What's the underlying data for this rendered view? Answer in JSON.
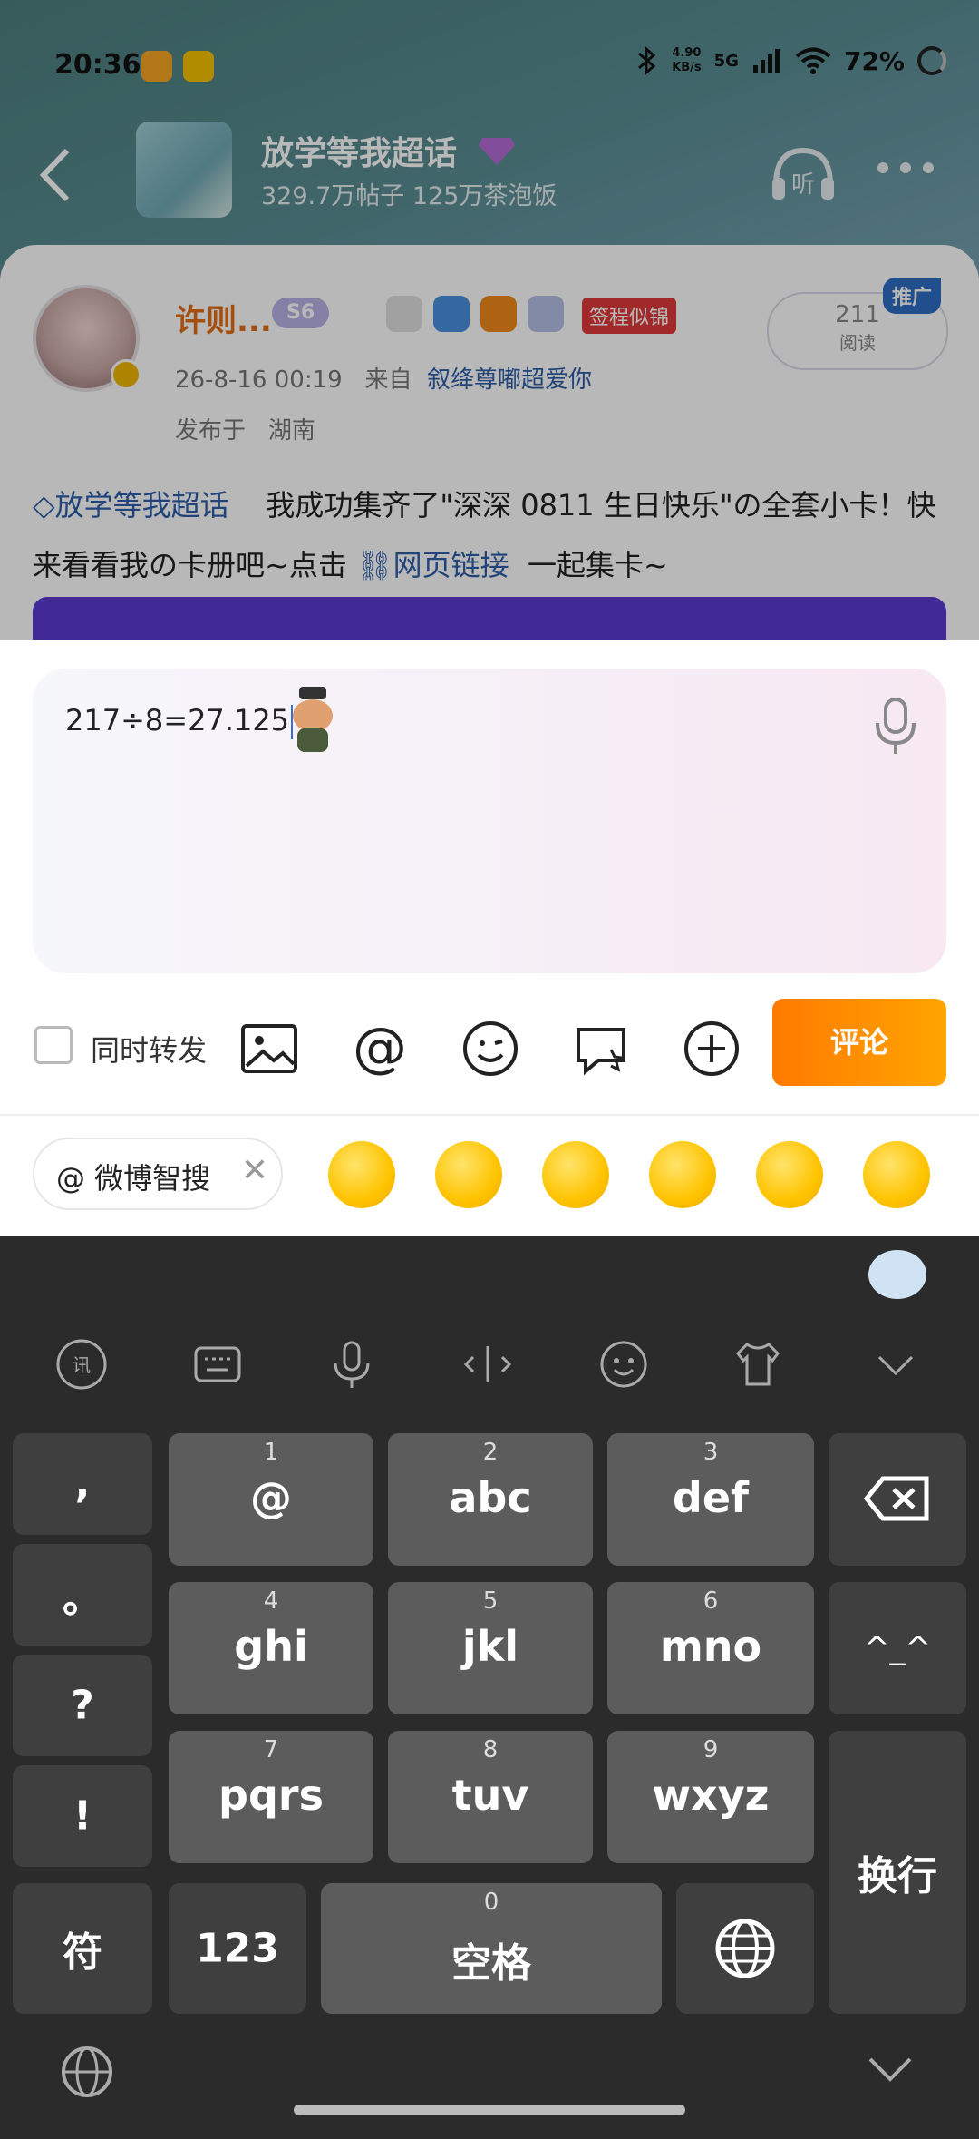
{
  "status": {
    "time": "20:36",
    "net_speed_value": "4.90",
    "net_speed_unit": "KB/s",
    "network": "5G",
    "battery": "72%"
  },
  "nav": {
    "topic_title": "放学等我超话",
    "topic_subtitle": "329.7万帖子 125万茶泡饭"
  },
  "post": {
    "author": "许则...",
    "level": "S6",
    "tag": "签程似锦",
    "datetime": "26-8-16  00:19",
    "source_prefix": "来自",
    "source": "叙绛尊嘟超爱你",
    "location_prefix": "发布于",
    "location": "湖南",
    "read_count": "211",
    "read_label": "阅读",
    "promo": "推广",
    "text_topic": "放学等我超话",
    "text_body": "我成功集齐了\"深深 0811 生日快乐\"の全套小卡！快来看看我の卡册吧~点击",
    "text_link": "网页链接",
    "text_tail": "一起集卡~"
  },
  "composer": {
    "input_value": "217÷8=27.125",
    "repost_label": "同时转发",
    "submit_label": "评论"
  },
  "suggest": {
    "mention_chip": "@ 微博智搜"
  },
  "keyboard": {
    "punct": [
      ",",
      "。",
      "?",
      "!"
    ],
    "keys": [
      {
        "num": "1",
        "label": "@"
      },
      {
        "num": "2",
        "label": "abc"
      },
      {
        "num": "3",
        "label": "def"
      },
      {
        "num": "4",
        "label": "ghi"
      },
      {
        "num": "5",
        "label": "jkl"
      },
      {
        "num": "6",
        "label": "mno"
      },
      {
        "num": "7",
        "label": "pqrs"
      },
      {
        "num": "8",
        "label": "tuv"
      },
      {
        "num": "9",
        "label": "wxyz"
      }
    ],
    "emoticon": "^_^",
    "enter": "换行",
    "symbol": "符",
    "numeric": "123",
    "space_num": "0",
    "space": "空格"
  },
  "colors": {
    "accent_orange": "#ff8c00",
    "link_blue": "#2d5da8",
    "author_orange": "#e56e16"
  }
}
